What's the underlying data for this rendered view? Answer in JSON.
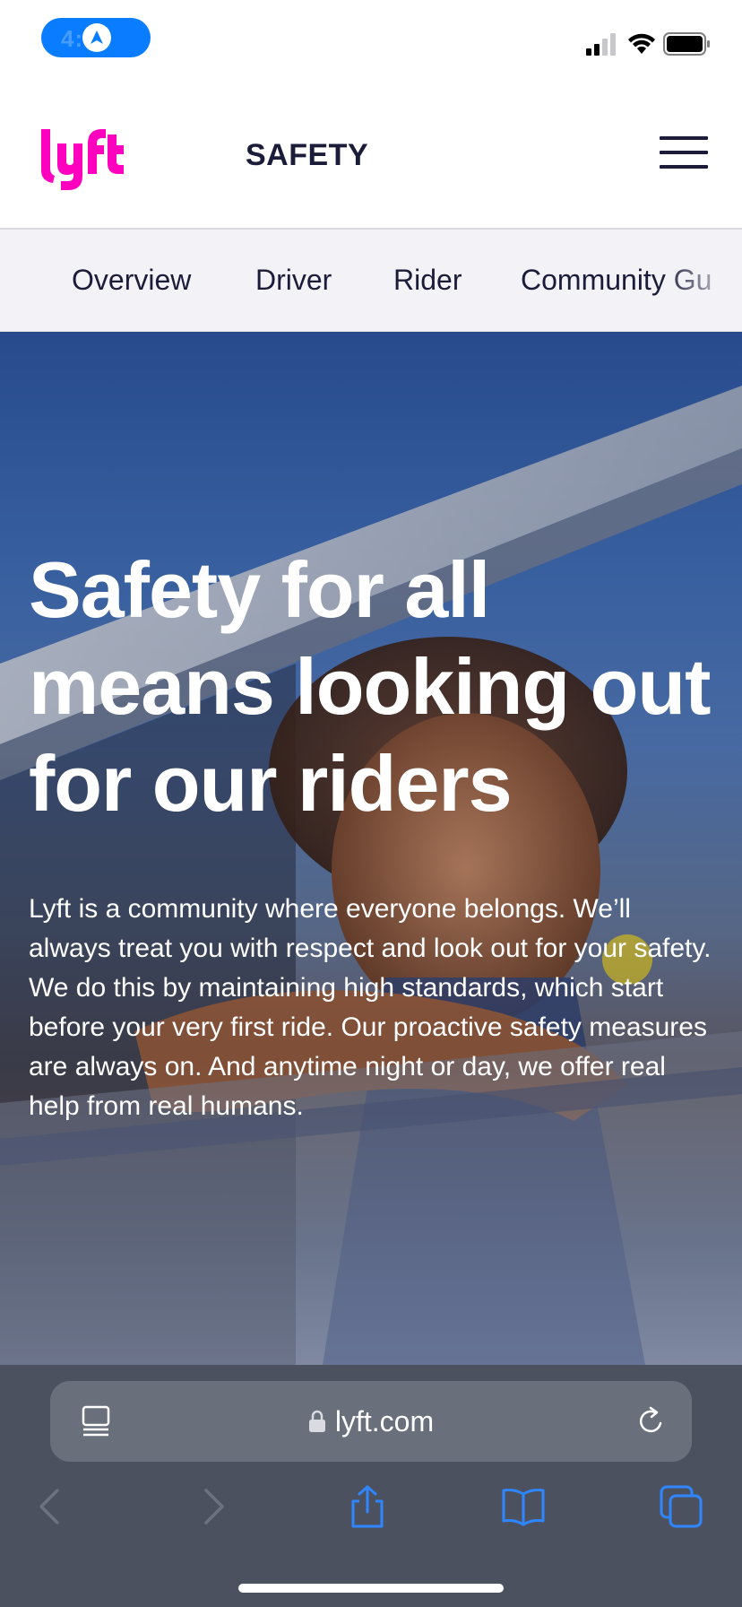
{
  "status_bar": {
    "time": "4:09",
    "icons": [
      "location-arrow-icon",
      "cellular-signal-icon",
      "wifi-icon",
      "battery-icon"
    ]
  },
  "header": {
    "logo_text": "lyft",
    "page_label": "SAFETY",
    "menu_icon": "hamburger-menu-icon"
  },
  "subnav": {
    "items": [
      {
        "label": "Overview"
      },
      {
        "label": "Driver"
      },
      {
        "label": "Rider"
      },
      {
        "label": "Community Gu"
      }
    ]
  },
  "hero": {
    "title": "Safety for all means looking out for our riders",
    "body": "Lyft is a community where everyone belongs. We’ll always treat you with respect and look out for your safety. We do this by maintaining high standards, which start before your very first ride. Our proactive safety measures are always on. And anytime night or day, we offer real help from real humans."
  },
  "browser": {
    "url": "lyft.com",
    "icons": [
      "reader-mode-icon",
      "lock-icon",
      "reload-icon",
      "back-icon",
      "forward-icon",
      "share-icon",
      "bookmarks-icon",
      "tabs-icon"
    ]
  },
  "colors": {
    "brand_pink": "#ff00bf",
    "navy": "#1b1b3a",
    "browser_bar": "#4c5160",
    "ios_blue": "#0a7cff"
  }
}
